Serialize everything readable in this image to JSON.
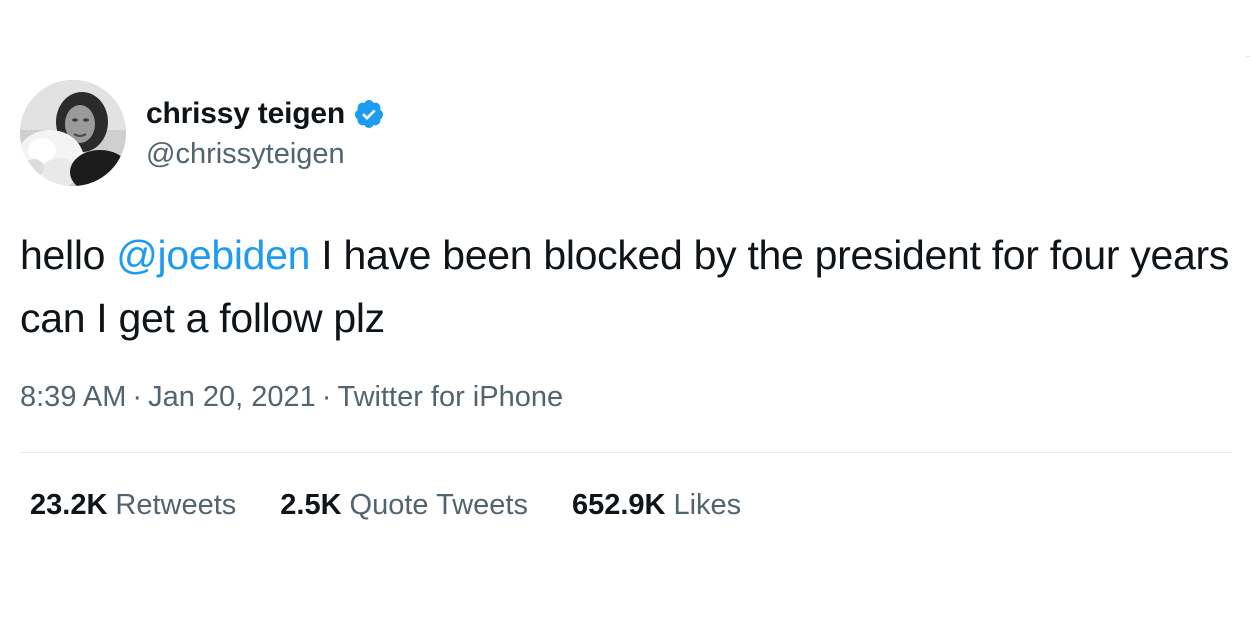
{
  "user": {
    "display_name": "chrissy teigen",
    "handle": "@chrissyteigen",
    "verified": true
  },
  "tweet": {
    "text_before_mention": "hello ",
    "mention": "@joebiden",
    "text_after_mention": " I have been blocked by the president for four years can I get a follow plz",
    "time": "8:39 AM",
    "date": "Jan 20, 2021",
    "source": "Twitter for iPhone",
    "separator": "·"
  },
  "stats": [
    {
      "count": "23.2K",
      "label": "Retweets"
    },
    {
      "count": "2.5K",
      "label": "Quote Tweets"
    },
    {
      "count": "652.9K",
      "label": "Likes"
    }
  ],
  "colors": {
    "mention": "#1d9bf0",
    "verified_badge": "#1d9bf0",
    "secondary_text": "#536471",
    "primary_text": "#0f1419"
  },
  "icons": {
    "verified": "verified-badge-icon",
    "avatar": "profile-photo"
  }
}
